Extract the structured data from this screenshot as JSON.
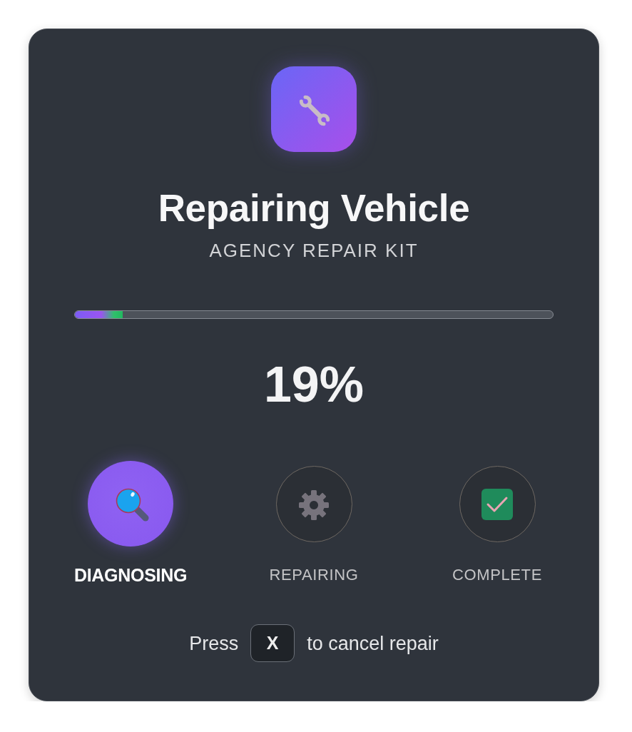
{
  "dialog": {
    "title": "Repairing Vehicle",
    "subtitle": "AGENCY REPAIR KIT"
  },
  "progress": {
    "level": 0.1,
    "percent": "19%"
  },
  "steps": [
    {
      "label": "DIAGNOSING",
      "selected": true
    },
    {
      "label": "REPAIRING",
      "selected": false
    },
    {
      "label": "COMPLETE",
      "selected": false
    }
  ],
  "footer": {
    "before": "Press",
    "key": "X",
    "after": "to cancel repair"
  }
}
